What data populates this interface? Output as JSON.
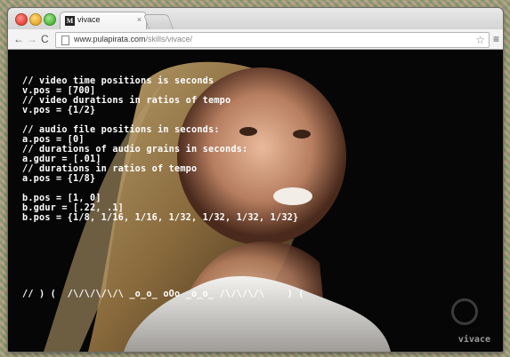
{
  "browser": {
    "tab_title": "vivace",
    "tab_favicon": "M",
    "tab_close": "×",
    "url_host": "www.pulapirata.com",
    "url_path": "/skills/vivace/",
    "nav": {
      "back": "←",
      "forward": "→",
      "reload": "C"
    },
    "star": "☆",
    "menu": "≡"
  },
  "code_lines": {
    "l1": "// video time positions is seconds",
    "l2": "v.pos = [700]",
    "l3": "// video durations in ratios of tempo",
    "l4": "v.pos = {1/2}",
    "l5": "// audio file positions in seconds:",
    "l6": "a.pos = [0]",
    "l7": "// durations of audio grains in seconds:",
    "l8": "a.gdur = [.01]",
    "l9": "// durations in ratios of tempo",
    "l10": "a.pos = {1/8}",
    "l11": "b.pos = [1, 0]",
    "l12": "b.gdur = [.22, .1]",
    "l13": "b.pos = {1/8, 1/16, 1/16, 1/32, 1/32, 1/32, 1/32}",
    "l14": "// ) (  /\\/\\/\\/\\/\\ _o_o_ oOo _o_o_ /\\/\\/\\/\\    ) ("
  },
  "watermark": "vivace",
  "colors": {
    "code_text": "#ffffff",
    "video_bg": "#060606",
    "watermark": "#9a9a9a"
  },
  "icons": {
    "back": "arrow-left-icon",
    "forward": "arrow-right-icon",
    "reload": "reload-icon",
    "page": "page-icon",
    "star": "star-icon",
    "menu": "hamburger-menu-icon",
    "tv_logo": "tv-logo-icon"
  }
}
